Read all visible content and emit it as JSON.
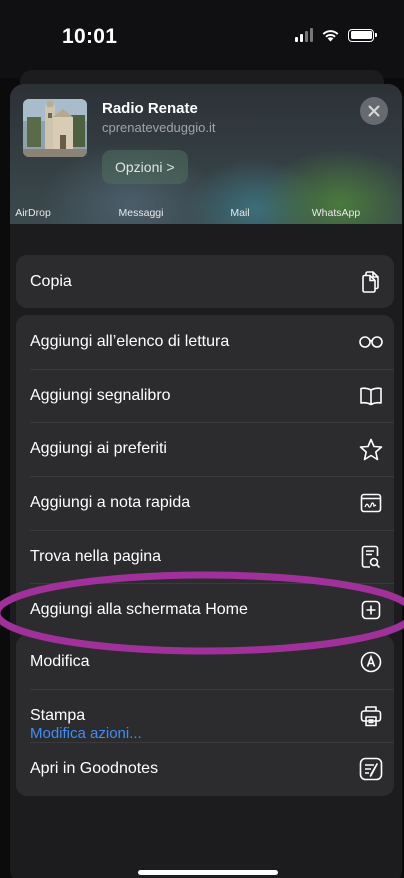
{
  "status_bar": {
    "time": "10:01",
    "signal_icon": "cellular-signal-icon",
    "wifi_icon": "wifi-icon",
    "battery_icon": "battery-icon"
  },
  "share_header": {
    "title": "Radio Renate",
    "url": "cprenateveduggio.it",
    "options_label": "Opzioni >",
    "close_icon": "close-icon"
  },
  "share_targets": [
    {
      "label": "AirDrop"
    },
    {
      "label": "Messaggi"
    },
    {
      "label": "Mail"
    },
    {
      "label": "WhatsApp"
    }
  ],
  "actions": {
    "group1": [
      {
        "label": "Copia",
        "icon": "copy-icon"
      }
    ],
    "group2": [
      {
        "label": "Aggiungi all’elenco di lettura",
        "icon": "glasses-icon"
      },
      {
        "label": "Aggiungi segnalibro",
        "icon": "book-icon"
      },
      {
        "label": "Aggiungi ai preferiti",
        "icon": "star-icon"
      },
      {
        "label": "Aggiungi a nota rapida",
        "icon": "quick-note-icon"
      },
      {
        "label": "Trova nella pagina",
        "icon": "find-in-page-icon"
      },
      {
        "label": "Aggiungi alla schermata Home",
        "icon": "add-square-icon"
      }
    ],
    "group3": [
      {
        "label": "Modifica",
        "icon": "markup-icon"
      },
      {
        "label": "Stampa",
        "icon": "printer-icon"
      },
      {
        "label": "Apri in Goodnotes",
        "icon": "goodnotes-icon"
      }
    ]
  },
  "edit_actions_label": "Modifica azioni...",
  "colors": {
    "accent": "#3d8ef6",
    "highlight": "#a0319a",
    "sheet": "#1c1c1e",
    "row": "#2c2c2e"
  }
}
